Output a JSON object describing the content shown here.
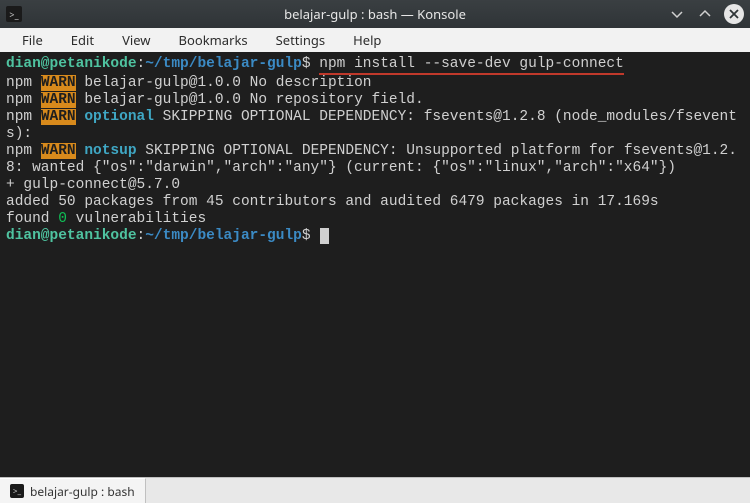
{
  "titlebar": {
    "title": "belajar-gulp : bash — Konsole",
    "terminal_icon": ">_"
  },
  "menubar": {
    "items": [
      "File",
      "Edit",
      "View",
      "Bookmarks",
      "Settings",
      "Help"
    ]
  },
  "terminal": {
    "prompt1": {
      "user": "dian@petanikode",
      "colon": ":",
      "path": "~/tmp/belajar-gulp",
      "dollar": "$",
      "command": "npm install --save-dev gulp-connect"
    },
    "out": {
      "l1a": "npm ",
      "l1b": "WARN",
      "l1c": " belajar-gulp@1.0.0 No description",
      "l2a": "npm ",
      "l2b": "WARN",
      "l2c": " belajar-gulp@1.0.0 No repository field.",
      "l3a": "npm ",
      "l3b": "WARN",
      "l3c": " ",
      "l3d": "optional",
      "l3e": " SKIPPING OPTIONAL DEPENDENCY: fsevents@1.2.8 (node_modules/fsevents):",
      "l4a": "npm ",
      "l4b": "WARN",
      "l4c": " ",
      "l4d": "notsup",
      "l4e": " SKIPPING OPTIONAL DEPENDENCY: Unsupported platform for fsevents@1.2.8: wanted {\"os\":\"darwin\",\"arch\":\"any\"} (current: {\"os\":\"linux\",\"arch\":\"x64\"})",
      "blank1": "",
      "success1a": "+ ",
      "success1b": "gulp-connect@5.7.0",
      "added": "added 50 packages from 45 contributors and audited 6479 packages in 17.169s",
      "found1": "found ",
      "found2": "0",
      "found3": " vulnerabilities",
      "blank2": ""
    },
    "prompt2": {
      "user": "dian@petanikode",
      "colon": ":",
      "path": "~/tmp/belajar-gulp",
      "dollar": "$"
    }
  },
  "tab": {
    "icon": ">_",
    "label": "belajar-gulp : bash"
  }
}
